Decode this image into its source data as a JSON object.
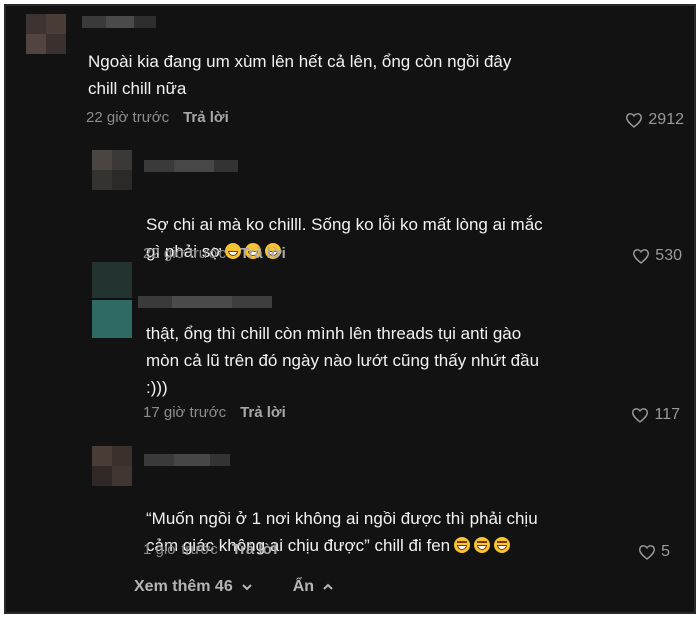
{
  "comments": [
    {
      "text": "Ngoài kia đang um xùm lên hết cả lên, ổng còn ngồi đây\nchill chill nữa",
      "time": "22 giờ trước",
      "reply": "Trả lời",
      "likes": "2912"
    },
    {
      "text": "Sợ chi ai mà ko chilll. Sống ko lỗi ko mất lòng ai mắc\ngì phải sợ",
      "emoji": [
        "grin-icon",
        "grin-icon",
        "grin-icon"
      ],
      "time": "22 giờ trước",
      "reply": "Trả lời",
      "likes": "530"
    },
    {
      "text": "thật, ổng thì chill còn mình lên threads tụi anti gào\nmòn cả lũ trên đó ngày nào lướt cũng thấy nhứt đầu\n:)))",
      "time": "17 giờ trước",
      "reply": "Trả lời",
      "likes": "117"
    },
    {
      "text": "“Muốn ngồi ở 1 nơi không ai ngồi được thì phải chịu\ncảm giác không ai chịu được” chill đi fen",
      "emoji": [
        "laugh-icon",
        "laugh-icon",
        "laugh-icon"
      ],
      "time": "1 giờ trước",
      "reply": "Trả lời",
      "likes": "5"
    }
  ],
  "footer": {
    "view_more": "Xem thêm 46",
    "hide": "Ẩn"
  },
  "colors": {
    "background": "#121212",
    "text": "#f2f2f2",
    "muted": "#8e8e8e"
  }
}
